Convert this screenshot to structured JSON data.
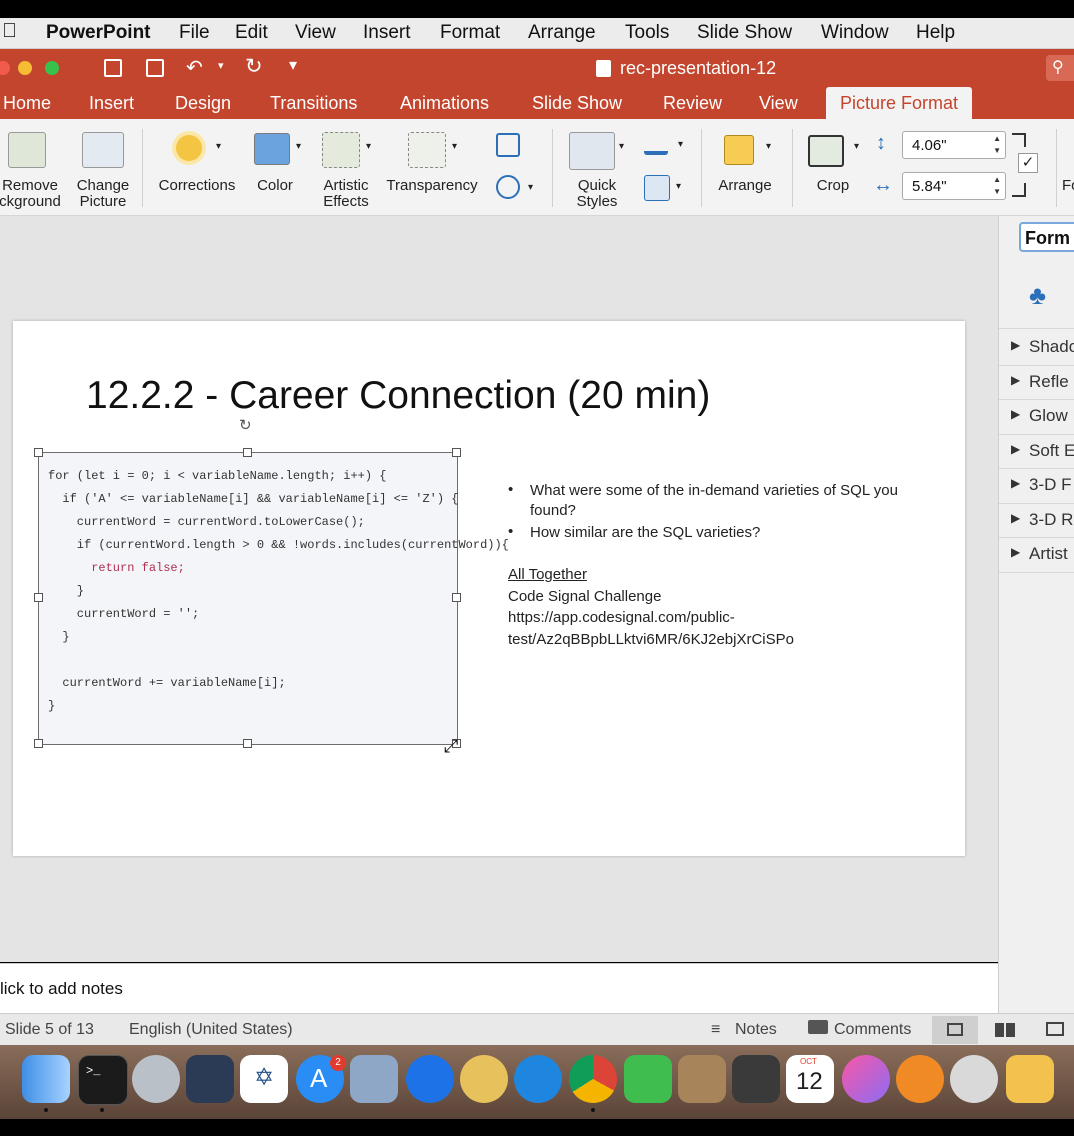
{
  "menubar": {
    "app": "PowerPoint",
    "items": [
      "File",
      "Edit",
      "View",
      "Insert",
      "Format",
      "Arrange",
      "Tools",
      "Slide Show",
      "Window",
      "Help"
    ]
  },
  "titlebar": {
    "doc_title": "rec-presentation-12"
  },
  "tabs": [
    "Home",
    "Insert",
    "Design",
    "Transitions",
    "Animations",
    "Slide Show",
    "Review",
    "View",
    "Picture Format"
  ],
  "ribbon": {
    "remove_background": "Remove\nckground",
    "change_picture": "Change\nPicture",
    "corrections": "Corrections",
    "color": "Color",
    "artistic_effects": "Artistic\nEffects",
    "transparency": "Transparency",
    "quick_styles": "Quick\nStyles",
    "arrange": "Arrange",
    "crop": "Crop",
    "height_value": "4.06\"",
    "width_value": "5.84\"",
    "fo_label": "Fo"
  },
  "slide": {
    "title": "12.2.2 - Career Connection (20 min)",
    "code_lines": [
      "for (let i = 0; i < variableName.length; i++) {",
      "  if ('A' <= variableName[i] && variableName[i] <= 'Z') {",
      "    currentWord = currentWord.toLowerCase();",
      "    if (currentWord.length > 0 && !words.includes(currentWord)){",
      "      return false;",
      "    }",
      "    currentWord = '';",
      "  }",
      "",
      "  currentWord += variableName[i];",
      "}"
    ],
    "bullets": [
      "What were some of the in-demand varieties of SQL you found?",
      "How similar are the SQL varieties?"
    ],
    "all_together": "All Together",
    "challenge": "Code Signal Challenge",
    "link_line1": "https://app.codesignal.com/public-",
    "link_line2": "test/Az2qBBpbLLktvi6MR/6KJ2ebjXrCiSPo"
  },
  "notes_placeholder": "lick to add notes",
  "status": {
    "slide_info": "Slide 5 of 13",
    "language": "English (United States)",
    "notes": "Notes",
    "comments": "Comments"
  },
  "right_pane": {
    "tab": "Form",
    "items": [
      "Shado",
      "Refle",
      "Glow",
      "Soft E",
      "3-D F",
      "3-D R",
      "Artist"
    ]
  },
  "dock": {
    "calendar_month": "OCT",
    "calendar_day": "12",
    "appstore_badge": "2"
  },
  "colors": {
    "accent": "#c4452e",
    "ribbon_bg": "#f3f3f3"
  }
}
